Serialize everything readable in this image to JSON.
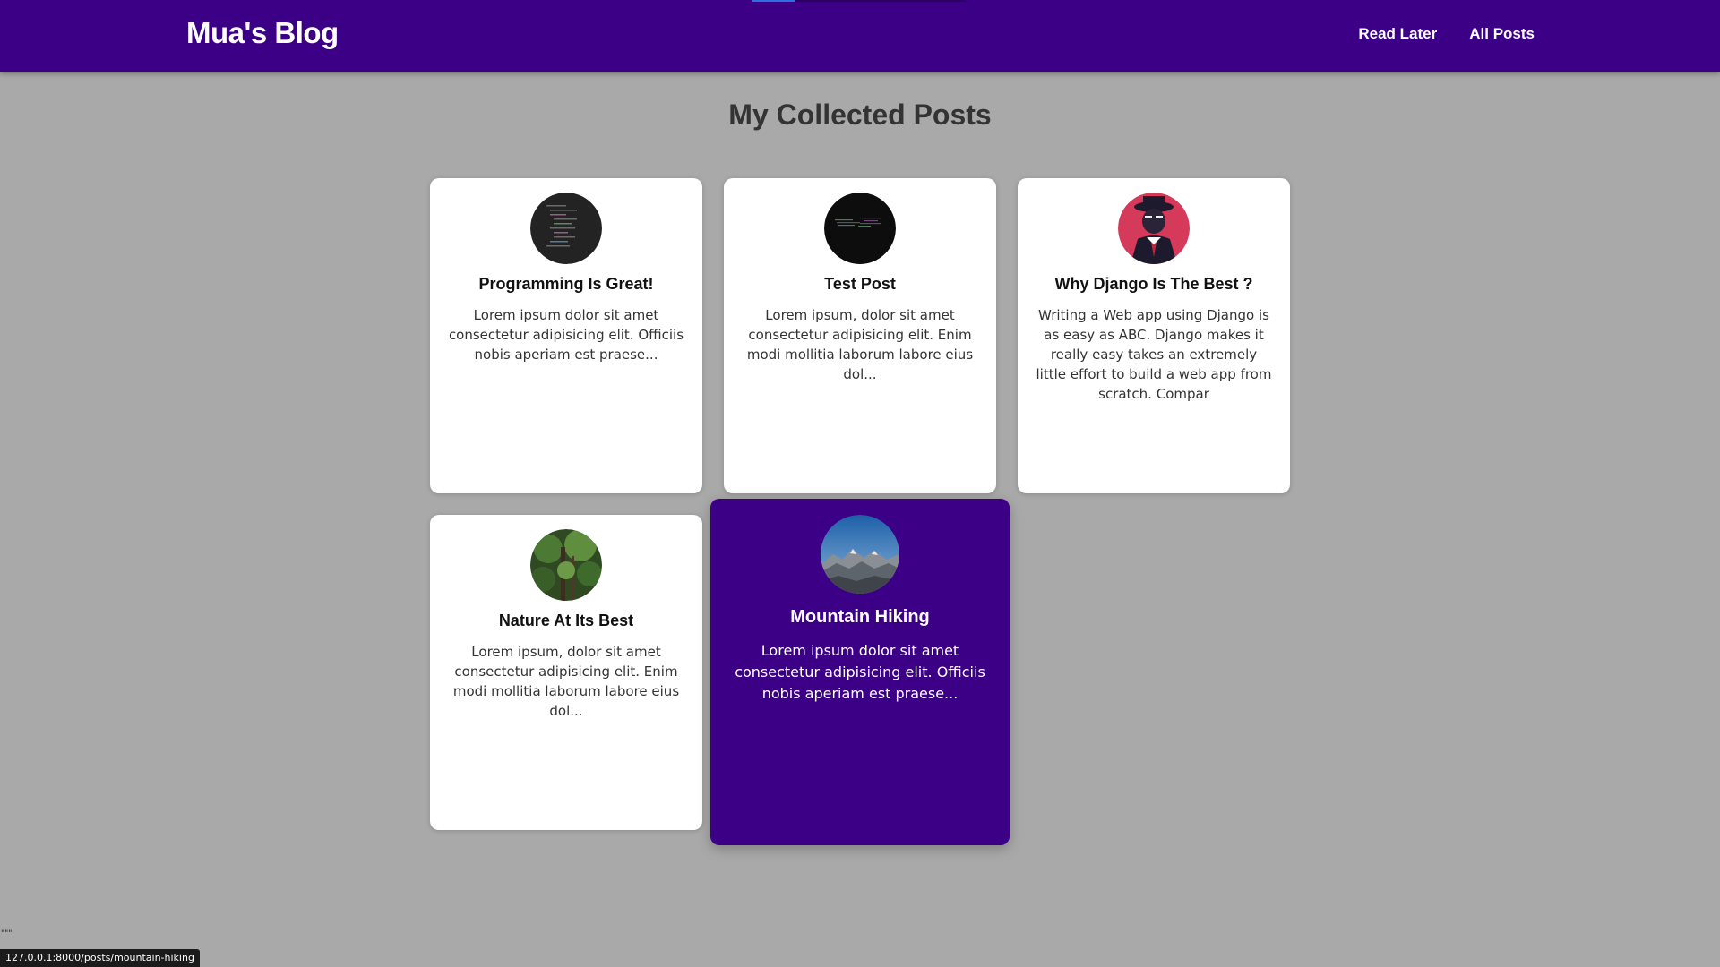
{
  "header": {
    "logo": "Mua's Blog",
    "nav": [
      {
        "label": "Read Later"
      },
      {
        "label": "All Posts"
      }
    ],
    "background_color": "#3c0087"
  },
  "main": {
    "title": "My Collected Posts",
    "posts": [
      {
        "title": "Programming Is Great!",
        "excerpt": "Lorem ipsum dolor sit amet consectetur adipisicing elit. Officiis nobis aperiam est praese...",
        "image": "code-screen-thumbnail"
      },
      {
        "title": "Test Post",
        "excerpt": "Lorem ipsum, dolor sit amet consectetur adipisicing elit. Enim modi mollitia laborum labore eius dol...",
        "image": "dark-code-thumbnail"
      },
      {
        "title": "Why Django Is The Best ?",
        "excerpt": "Writing a Web app using Django is as easy as ABC. Django makes it really easy takes an extremely little effort to build a web app from scratch. Compar",
        "image": "hat-man-illustration"
      },
      {
        "title": "Nature At Its Best",
        "excerpt": "Lorem ipsum, dolor sit amet consectetur adipisicing elit. Enim modi mollitia laborum labore eius dol...",
        "image": "forest-thumbnail"
      },
      {
        "title": "Mountain Hiking",
        "excerpt": "Lorem ipsum dolor sit amet consectetur adipisicing elit. Officiis nobis aperiam est praese...",
        "image": "mountain-thumbnail",
        "hovered": true
      }
    ]
  },
  "status_bar": {
    "url": "127.0.0.1:8000/posts/mountain-hiking"
  },
  "stray_text": "\"\"\""
}
